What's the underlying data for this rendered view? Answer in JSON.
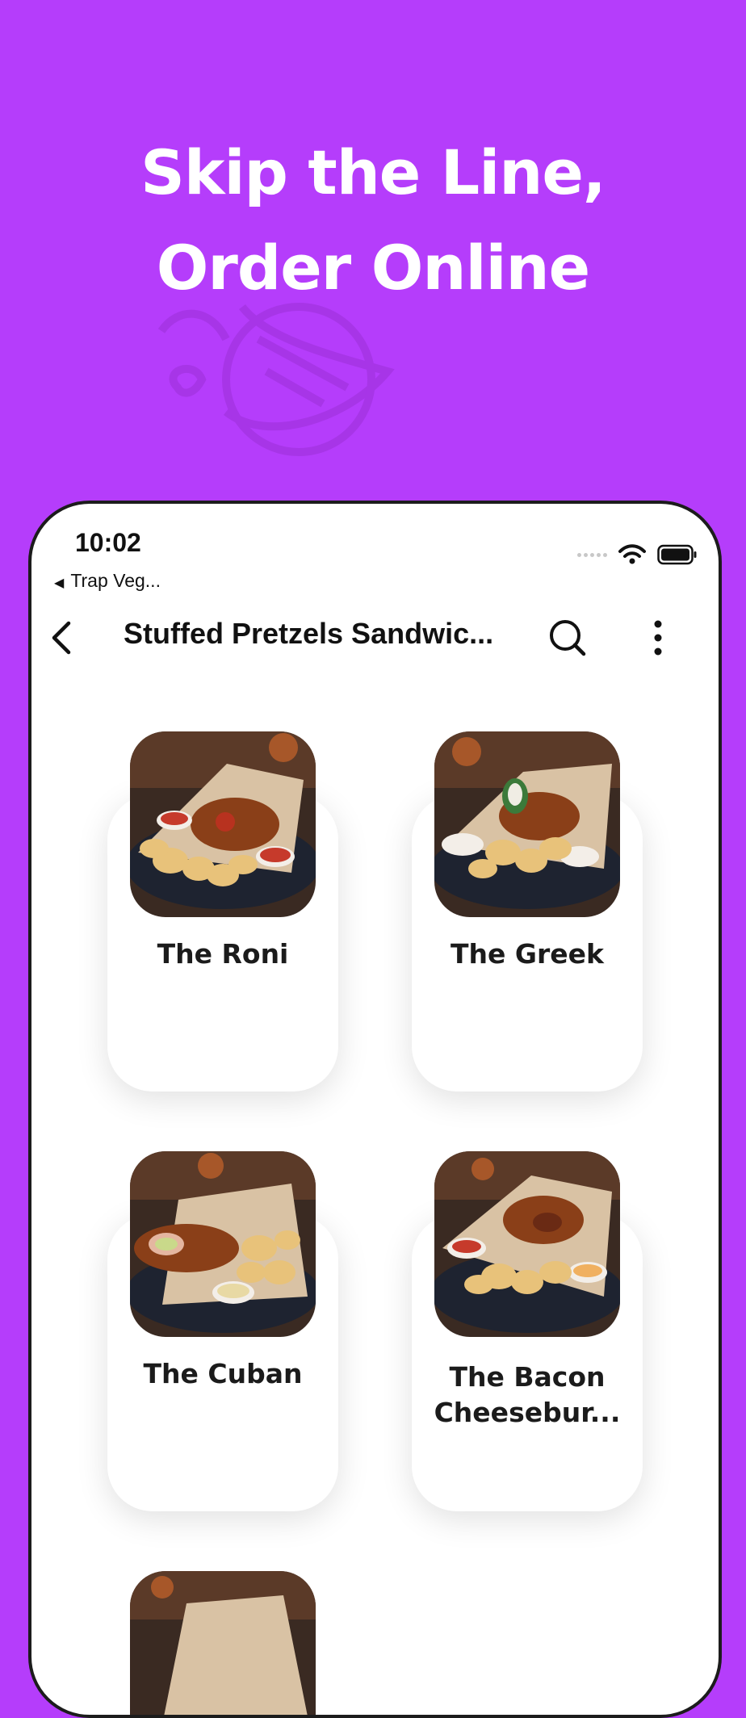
{
  "promo": {
    "headline_line1": "Skip the Line,",
    "headline_line2": "Order Online"
  },
  "status_bar": {
    "time": "10:02",
    "back_app": "Trap Veg..."
  },
  "toolbar": {
    "title": "Stuffed Pretzels Sandwic..."
  },
  "menu_items": [
    {
      "name": "The Roni"
    },
    {
      "name": "The Greek"
    },
    {
      "name": "The Cuban"
    },
    {
      "name": "The Bacon Cheesebur..."
    }
  ],
  "colors": {
    "background": "#b53dfb",
    "card": "#ffffff",
    "text": "#1b1b1b"
  },
  "icons": [
    "back-chevron-icon",
    "search-icon",
    "more-vertical-icon",
    "wifi-icon",
    "battery-icon",
    "signal-dots-icon"
  ]
}
